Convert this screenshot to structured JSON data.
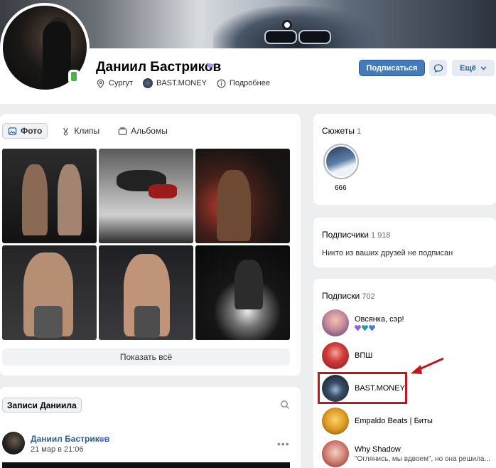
{
  "profile": {
    "name": "Даниил Бастриков",
    "city": "Сургут",
    "community": "BAST.MONEY",
    "details": "Подробнее",
    "subscribe_label": "Подписаться",
    "more_label": "Ещё"
  },
  "photos": {
    "tabs": [
      {
        "label": "Фото",
        "icon": "image-icon",
        "active": true
      },
      {
        "label": "Клипы",
        "icon": "clip-icon",
        "active": false
      },
      {
        "label": "Альбомы",
        "icon": "album-icon",
        "active": false
      }
    ],
    "show_all_label": "Показать всё"
  },
  "wall": {
    "tab_label": "Записи Даниила",
    "post": {
      "author": "Даниил Бастриков",
      "date": "21 мар в 21:06"
    }
  },
  "stories": {
    "title": "Сюжеты",
    "count": "1",
    "item_label": "666"
  },
  "followers": {
    "title": "Подписчики",
    "count": "1 918",
    "note": "Никто из ваших друзей не подписан"
  },
  "subscriptions": {
    "title": "Подписки",
    "count": "702",
    "items": [
      {
        "name": "Овсянка, сэр!",
        "sub": ""
      },
      {
        "name": "ВПШ",
        "sub": ""
      },
      {
        "name": "BAST.MONEY",
        "sub": ""
      },
      {
        "name": "Empaldo Beats | Биты",
        "sub": ""
      },
      {
        "name": "Why Shadow",
        "sub": "\"Оглянись, мы вдвоем\", но она решила..."
      }
    ]
  },
  "colors": {
    "accent": "#447bba",
    "link": "#2c5d94",
    "highlight": "#c0161c",
    "verified": "#a393f5"
  }
}
